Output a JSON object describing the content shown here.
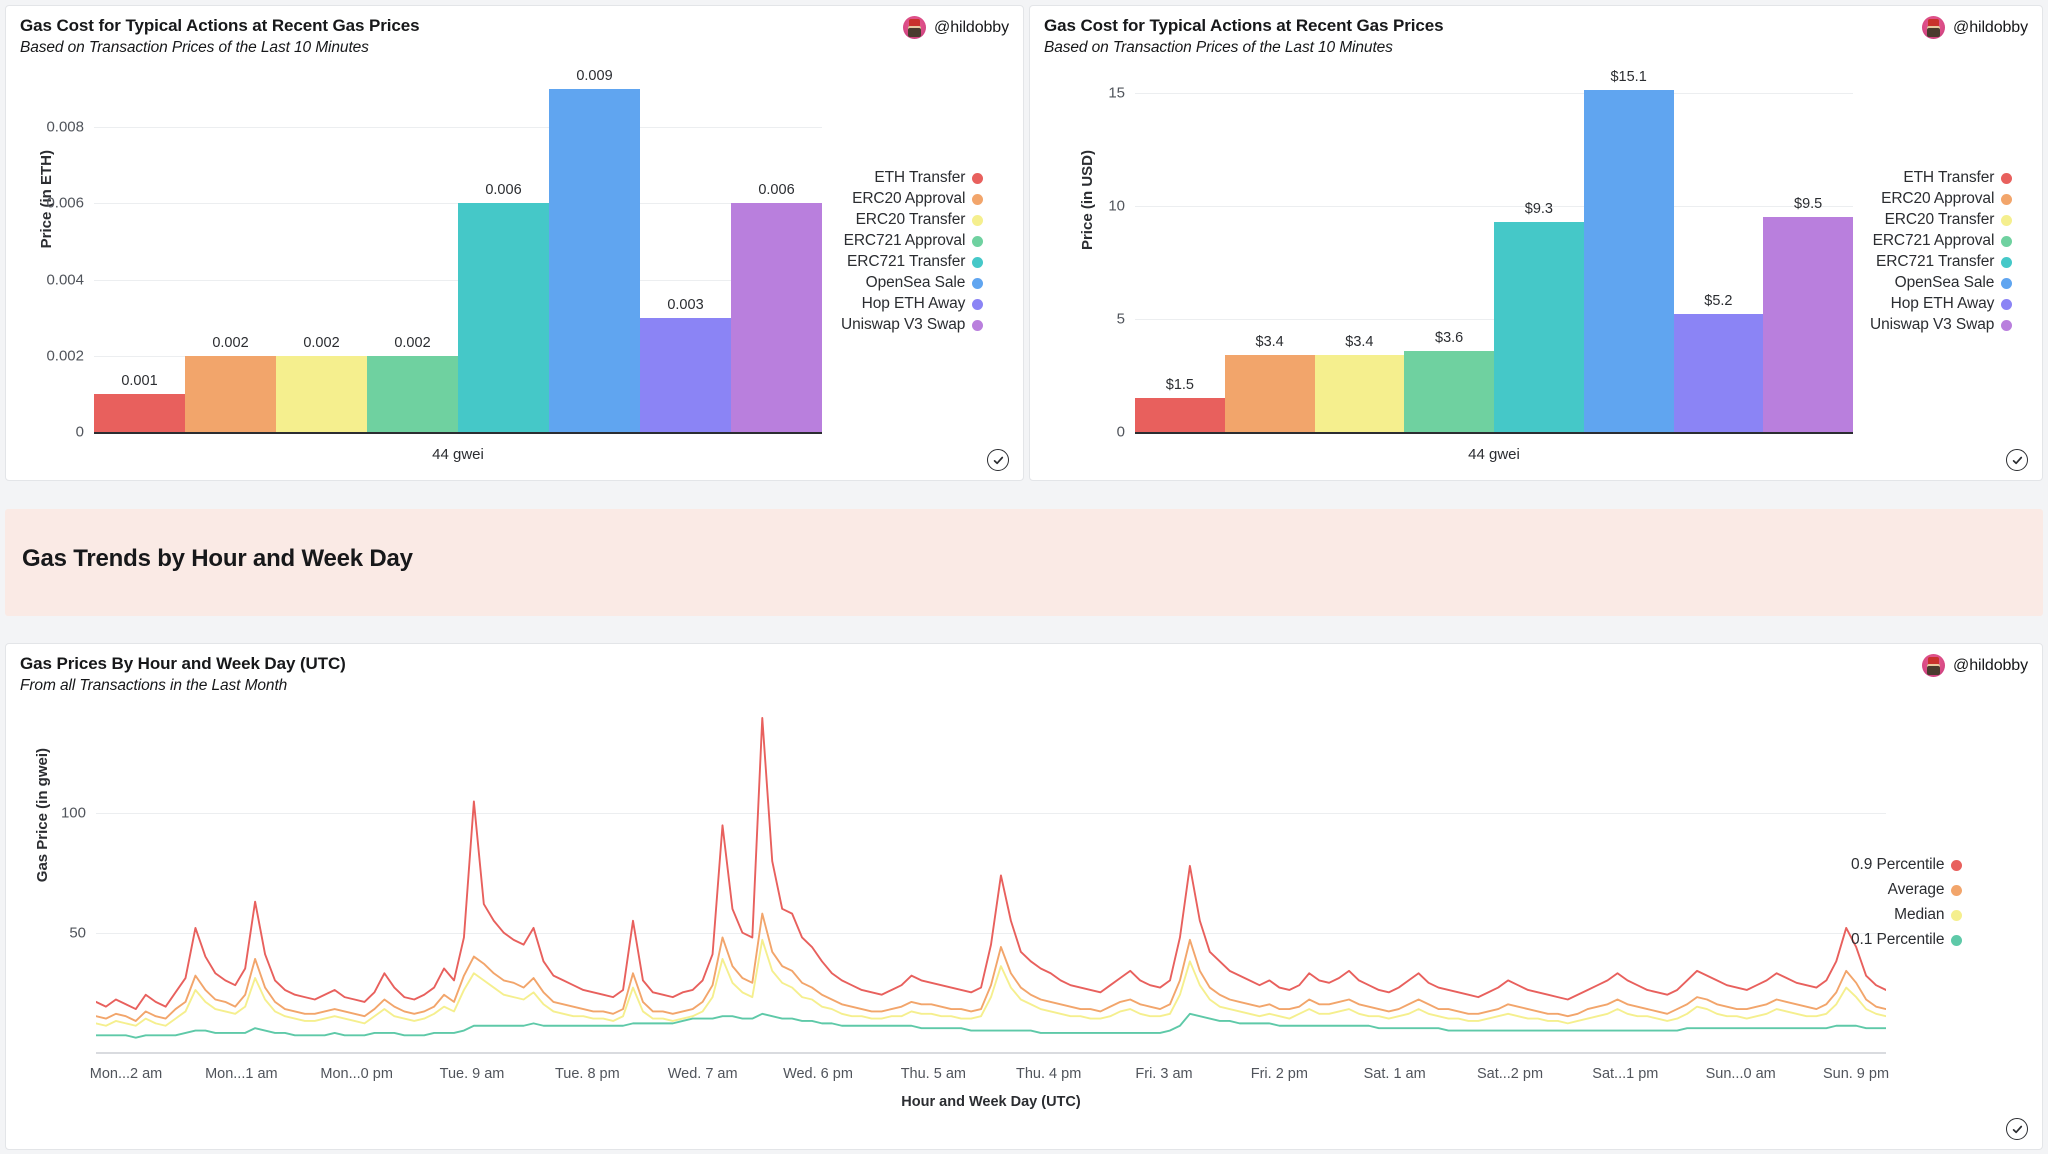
{
  "user": {
    "handle": "@hildobby",
    "avatar_icon": "avatar-pixel-icon"
  },
  "panels": {
    "eth": {
      "title": "Gas Cost for Typical Actions at Recent Gas Prices",
      "subtitle": "Based on Transaction Prices of the Last 10 Minutes",
      "check_icon": "check-circle-icon"
    },
    "usd": {
      "title": "Gas Cost for Typical Actions at Recent Gas Prices",
      "subtitle": "Based on Transaction Prices of the Last 10 Minutes",
      "check_icon": "check-circle-icon"
    },
    "lines": {
      "title": "Gas Prices By Hour and Week Day (UTC)",
      "subtitle": "From all Transactions in the Last Month",
      "check_icon": "check-circle-icon"
    }
  },
  "section": {
    "title": "Gas Trends by Hour and Week Day"
  },
  "palette": {
    "eth_transfer": "#e8605d",
    "erc20_approval": "#f2a56b",
    "erc20_transfer": "#f5ef8e",
    "erc721_approval": "#6fd1a0",
    "erc721_transfer": "#45c8c8",
    "opensea_sale": "#60a5f0",
    "hop_eth_away": "#8b84f5",
    "uniswap_v3_swap": "#b97fdd",
    "percentile_09": "#e8605d",
    "average": "#f2a56b",
    "median": "#f5ef8e",
    "percentile_01": "#5ec9a8",
    "banner_bg": "#faeae5"
  },
  "chart_data": [
    {
      "id": "gas-cost-eth",
      "type": "bar",
      "title": "Gas Cost for Typical Actions at Recent Gas Prices",
      "subtitle": "Based on Transaction Prices of the Last 10 Minutes",
      "xlabel": "",
      "ylabel": "Price (in ETH)",
      "x_category": "44 gwei",
      "ylim": [
        0,
        0.0095
      ],
      "yticks": [
        "0",
        "0.002",
        "0.004",
        "0.006",
        "0.008"
      ],
      "ytick_values": [
        0,
        0.002,
        0.004,
        0.006,
        0.008
      ],
      "grid": true,
      "legend_position": "right",
      "categories": [
        "ETH Transfer",
        "ERC20 Approval",
        "ERC20 Transfer",
        "ERC721 Approval",
        "ERC721 Transfer",
        "OpenSea Sale",
        "Hop ETH Away",
        "Uniswap V3 Swap"
      ],
      "values": [
        0.001,
        0.002,
        0.002,
        0.002,
        0.006,
        0.009,
        0.003,
        0.006
      ],
      "data_labels": [
        "0.001",
        "0.002",
        "0.002",
        "0.002",
        "0.006",
        "0.009",
        "0.003",
        "0.006"
      ],
      "colors": [
        "#e8605d",
        "#f2a56b",
        "#f5ef8e",
        "#6fd1a0",
        "#45c8c8",
        "#60a5f0",
        "#8b84f5",
        "#b97fdd"
      ]
    },
    {
      "id": "gas-cost-usd",
      "type": "bar",
      "title": "Gas Cost for Typical Actions at Recent Gas Prices",
      "subtitle": "Based on Transaction Prices of the Last 10 Minutes",
      "xlabel": "",
      "ylabel": "Price (in USD)",
      "x_category": "44 gwei",
      "ylim": [
        0,
        16
      ],
      "yticks": [
        "0",
        "5",
        "10",
        "15"
      ],
      "ytick_values": [
        0,
        5,
        10,
        15
      ],
      "grid": true,
      "legend_position": "right",
      "categories": [
        "ETH Transfer",
        "ERC20 Approval",
        "ERC20 Transfer",
        "ERC721 Approval",
        "ERC721 Transfer",
        "OpenSea Sale",
        "Hop ETH Away",
        "Uniswap V3 Swap"
      ],
      "values": [
        1.5,
        3.4,
        3.4,
        3.6,
        9.3,
        15.1,
        5.2,
        9.5
      ],
      "data_labels": [
        "$1.5",
        "$3.4",
        "$3.4",
        "$3.6",
        "$9.3",
        "$15.1",
        "$5.2",
        "$9.5"
      ],
      "colors": [
        "#e8605d",
        "#f2a56b",
        "#f5ef8e",
        "#6fd1a0",
        "#45c8c8",
        "#60a5f0",
        "#8b84f5",
        "#b97fdd"
      ]
    },
    {
      "id": "gas-prices-by-hour",
      "type": "line",
      "title": "Gas Prices By Hour and Week Day (UTC)",
      "subtitle": "From all Transactions in the Last Month",
      "xlabel": "Hour and Week Day (UTC)",
      "ylabel": "Gas Price (in gwei)",
      "ylim": [
        0,
        145
      ],
      "yticks": [
        "50",
        "100"
      ],
      "ytick_values": [
        50,
        100
      ],
      "grid": true,
      "legend_position": "right",
      "xticks": [
        "Mon...2 am",
        "Mon...1 am",
        "Mon...0 pm",
        "Tue. 9 am",
        "Tue. 8 pm",
        "Wed. 7 am",
        "Wed. 6 pm",
        "Thu. 5 am",
        "Thu. 4 pm",
        "Fri. 3 am",
        "Fri. 2 pm",
        "Sat. 1 am",
        "Sat...2 pm",
        "Sat...1 pm",
        "Sun...0 am",
        "Sun. 9 pm"
      ],
      "series": [
        {
          "name": "0.9 Percentile",
          "color": "#e8605d",
          "values": [
            21,
            19,
            22,
            20,
            18,
            24,
            21,
            19,
            25,
            31,
            52,
            40,
            33,
            30,
            28,
            35,
            63,
            41,
            30,
            26,
            24,
            23,
            22,
            24,
            26,
            23,
            22,
            21,
            25,
            33,
            27,
            23,
            22,
            24,
            27,
            35,
            30,
            48,
            105,
            62,
            55,
            50,
            47,
            45,
            52,
            38,
            32,
            30,
            28,
            26,
            25,
            24,
            23,
            26,
            55,
            30,
            25,
            24,
            23,
            25,
            26,
            30,
            41,
            95,
            60,
            50,
            48,
            140,
            80,
            60,
            58,
            48,
            44,
            38,
            33,
            30,
            28,
            26,
            25,
            24,
            26,
            28,
            32,
            30,
            29,
            28,
            27,
            26,
            25,
            27,
            45,
            74,
            55,
            42,
            38,
            35,
            33,
            30,
            28,
            27,
            26,
            25,
            28,
            31,
            34,
            30,
            28,
            27,
            30,
            48,
            78,
            55,
            42,
            38,
            34,
            32,
            30,
            28,
            30,
            27,
            26,
            28,
            33,
            30,
            29,
            31,
            34,
            30,
            28,
            26,
            25,
            27,
            30,
            33,
            29,
            27,
            26,
            25,
            24,
            23,
            25,
            27,
            30,
            28,
            26,
            25,
            24,
            23,
            22,
            24,
            26,
            28,
            30,
            33,
            30,
            28,
            26,
            25,
            24,
            26,
            30,
            34,
            32,
            30,
            28,
            27,
            26,
            28,
            30,
            33,
            31,
            29,
            28,
            27,
            30,
            38,
            52,
            44,
            32,
            28,
            26
          ]
        },
        {
          "name": "Average",
          "color": "#f2a56b",
          "values": [
            15,
            14,
            16,
            15,
            13,
            17,
            15,
            14,
            18,
            21,
            32,
            26,
            22,
            21,
            19,
            24,
            39,
            27,
            21,
            18,
            17,
            16,
            16,
            17,
            18,
            17,
            16,
            15,
            18,
            22,
            19,
            17,
            16,
            17,
            19,
            24,
            21,
            32,
            40,
            37,
            33,
            30,
            29,
            27,
            31,
            25,
            21,
            20,
            19,
            18,
            17,
            17,
            16,
            18,
            33,
            21,
            17,
            17,
            16,
            17,
            18,
            21,
            28,
            48,
            36,
            31,
            29,
            58,
            42,
            36,
            34,
            29,
            27,
            24,
            22,
            20,
            19,
            18,
            17,
            17,
            18,
            19,
            21,
            20,
            20,
            19,
            18,
            18,
            17,
            18,
            28,
            44,
            33,
            27,
            24,
            22,
            21,
            20,
            19,
            18,
            18,
            17,
            19,
            21,
            22,
            20,
            19,
            18,
            20,
            30,
            47,
            34,
            27,
            24,
            22,
            21,
            20,
            19,
            20,
            18,
            18,
            19,
            22,
            20,
            20,
            21,
            22,
            20,
            19,
            18,
            17,
            18,
            20,
            22,
            20,
            18,
            18,
            17,
            16,
            16,
            17,
            18,
            20,
            19,
            18,
            17,
            16,
            16,
            15,
            16,
            18,
            19,
            20,
            22,
            20,
            19,
            18,
            17,
            16,
            18,
            20,
            23,
            22,
            20,
            19,
            18,
            18,
            19,
            20,
            22,
            21,
            20,
            19,
            18,
            20,
            25,
            34,
            29,
            22,
            19,
            18
          ]
        },
        {
          "name": "Median",
          "color": "#f5ef8e",
          "values": [
            12,
            11,
            13,
            12,
            11,
            14,
            12,
            11,
            14,
            17,
            26,
            21,
            18,
            17,
            16,
            19,
            31,
            22,
            17,
            15,
            14,
            13,
            13,
            14,
            15,
            14,
            13,
            12,
            15,
            18,
            15,
            14,
            13,
            14,
            16,
            19,
            17,
            26,
            33,
            30,
            27,
            24,
            23,
            22,
            25,
            20,
            17,
            16,
            15,
            15,
            14,
            14,
            13,
            15,
            27,
            17,
            14,
            14,
            13,
            14,
            15,
            17,
            23,
            39,
            29,
            25,
            23,
            47,
            34,
            29,
            27,
            23,
            22,
            19,
            18,
            16,
            15,
            15,
            14,
            14,
            15,
            15,
            17,
            16,
            16,
            15,
            15,
            14,
            14,
            15,
            23,
            36,
            27,
            22,
            20,
            18,
            17,
            16,
            15,
            15,
            14,
            14,
            15,
            17,
            18,
            16,
            15,
            15,
            16,
            24,
            38,
            28,
            22,
            19,
            18,
            17,
            16,
            15,
            16,
            15,
            14,
            16,
            18,
            16,
            16,
            17,
            18,
            16,
            15,
            15,
            14,
            15,
            16,
            18,
            16,
            15,
            14,
            14,
            13,
            13,
            14,
            15,
            16,
            15,
            14,
            14,
            13,
            13,
            12,
            13,
            14,
            15,
            16,
            18,
            16,
            15,
            15,
            14,
            13,
            14,
            16,
            19,
            18,
            16,
            15,
            15,
            14,
            15,
            16,
            18,
            17,
            16,
            15,
            15,
            16,
            20,
            27,
            23,
            18,
            16,
            15
          ]
        },
        {
          "name": "0.1 Percentile",
          "color": "#5ec9a8",
          "values": [
            7,
            7,
            7,
            7,
            6,
            7,
            7,
            7,
            7,
            8,
            9,
            9,
            8,
            8,
            8,
            8,
            10,
            9,
            8,
            8,
            7,
            7,
            7,
            7,
            8,
            7,
            7,
            7,
            8,
            8,
            8,
            7,
            7,
            7,
            8,
            8,
            8,
            9,
            11,
            11,
            11,
            11,
            11,
            11,
            12,
            11,
            11,
            11,
            11,
            11,
            11,
            11,
            11,
            11,
            12,
            12,
            12,
            12,
            12,
            13,
            14,
            14,
            14,
            15,
            15,
            14,
            14,
            16,
            15,
            14,
            14,
            13,
            13,
            12,
            12,
            11,
            11,
            11,
            11,
            11,
            11,
            11,
            11,
            10,
            10,
            10,
            10,
            10,
            9,
            9,
            9,
            9,
            9,
            9,
            9,
            8,
            8,
            8,
            8,
            8,
            8,
            8,
            8,
            8,
            8,
            8,
            8,
            8,
            9,
            11,
            16,
            15,
            14,
            13,
            13,
            12,
            12,
            12,
            12,
            11,
            11,
            11,
            11,
            11,
            11,
            11,
            11,
            11,
            11,
            10,
            10,
            10,
            10,
            10,
            10,
            10,
            9,
            9,
            9,
            9,
            9,
            9,
            9,
            9,
            9,
            9,
            9,
            9,
            9,
            9,
            9,
            9,
            9,
            9,
            9,
            9,
            9,
            9,
            9,
            9,
            10,
            10,
            10,
            10,
            10,
            10,
            10,
            10,
            10,
            10,
            10,
            10,
            10,
            10,
            10,
            11,
            11,
            11,
            10,
            10,
            10
          ]
        }
      ]
    }
  ]
}
